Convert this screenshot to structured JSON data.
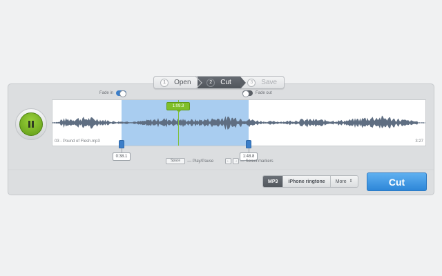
{
  "stepper": {
    "steps": [
      {
        "num": "1",
        "label": "Open"
      },
      {
        "num": "2",
        "label": "Cut"
      },
      {
        "num": "3",
        "label": "Save"
      }
    ]
  },
  "fade": {
    "in_label": "Fade in",
    "out_label": "Fade out"
  },
  "audio": {
    "file_name": "03 - Pound of Flesh.mp3",
    "duration": "3:27",
    "playhead_time": "1:09.3",
    "start_marker": "0:38.1",
    "end_marker": "1:48.8"
  },
  "shortcuts": {
    "space_key": "Space",
    "play_pause": "— Play/Pause",
    "left_key": "←",
    "right_key": "→",
    "select_markers": "— Select markers"
  },
  "formats": {
    "mp3": "MP3",
    "iphone": "iPhone ringtone",
    "more": "More"
  },
  "cut_button": "Cut",
  "colors": {
    "accent_blue": "#3b7ec9",
    "play_green": "#7fbf2a",
    "selection": "#a9cdf0"
  }
}
